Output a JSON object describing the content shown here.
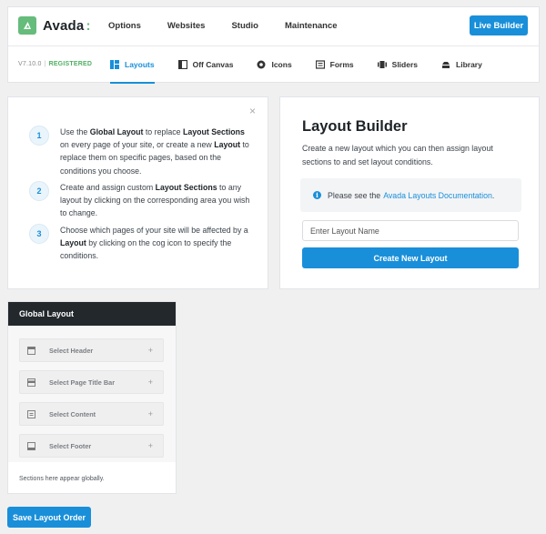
{
  "header": {
    "brand": "Avada",
    "brand_colon": ":",
    "nav": [
      "Options",
      "Websites",
      "Studio",
      "Maintenance"
    ],
    "live_builder_label": "Live Builder",
    "version": "V7.10.0",
    "registered": "REGISTERED",
    "tabs": [
      {
        "label": "Layouts",
        "icon": "layouts-icon",
        "active": true
      },
      {
        "label": "Off Canvas",
        "icon": "off-canvas-icon",
        "active": false
      },
      {
        "label": "Icons",
        "icon": "icons-icon",
        "active": false
      },
      {
        "label": "Forms",
        "icon": "forms-icon",
        "active": false
      },
      {
        "label": "Sliders",
        "icon": "sliders-icon",
        "active": false
      },
      {
        "label": "Library",
        "icon": "library-icon",
        "active": false
      }
    ],
    "accent_color": "#198fd9",
    "brand_color": "#65bc7b"
  },
  "steps": {
    "close": "×",
    "items": [
      {
        "num": "1"
      },
      {
        "num": "2"
      },
      {
        "num": "3"
      }
    ]
  },
  "builder": {
    "title": "Layout Builder",
    "description": "Create a new layout which you can then assign layout sections to and set layout conditions.",
    "notice_text": "Please see the",
    "notice_link": "Avada Layouts Documentation",
    "notice_end": ".",
    "input_placeholder": "Enter Layout Name",
    "create_label": "Create New Layout"
  },
  "global_layout": {
    "title": "Global Layout",
    "sections": [
      {
        "label": "Select Header",
        "icon": "header-icon"
      },
      {
        "label": "Select Page Title Bar",
        "icon": "page-title-bar-icon"
      },
      {
        "label": "Select Content",
        "icon": "content-icon"
      },
      {
        "label": "Select Footer",
        "icon": "footer-icon"
      }
    ],
    "plus": "+",
    "note": "Sections here appear globally."
  },
  "save_label": "Save Layout Order"
}
